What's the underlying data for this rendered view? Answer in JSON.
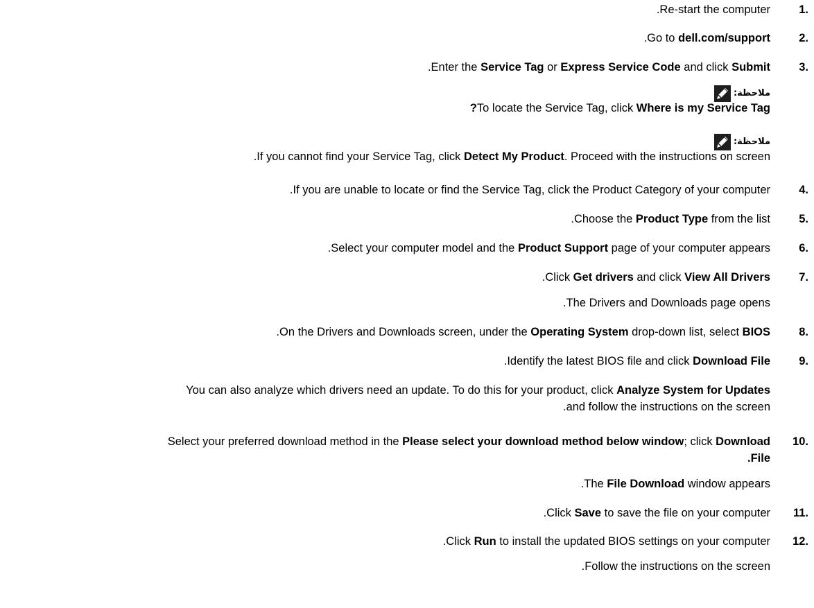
{
  "steps": [
    {
      "num": ".1",
      "parts": [
        {
          "t": ".Re-start the computer"
        }
      ]
    },
    {
      "num": ".2",
      "parts": [
        {
          "t": ".Go to "
        },
        {
          "t": "dell.com/support",
          "b": true
        }
      ]
    },
    {
      "num": ".3",
      "parts": [
        {
          "t": ".Enter the "
        },
        {
          "t": "Service Tag",
          "b": true
        },
        {
          "t": " or "
        },
        {
          "t": "Express Service Code",
          "b": true
        },
        {
          "t": " and click "
        },
        {
          "t": "Submit",
          "b": true
        }
      ]
    },
    {
      "num": ".4",
      "parts": [
        {
          "t": ".If you are unable to locate or find the Service Tag, click the Product Category of your computer"
        }
      ]
    },
    {
      "num": ".5",
      "parts": [
        {
          "t": ".Choose the "
        },
        {
          "t": "Product Type",
          "b": true
        },
        {
          "t": " from the list"
        }
      ]
    },
    {
      "num": ".6",
      "parts": [
        {
          "t": ".Select your computer model and the "
        },
        {
          "t": "Product Support",
          "b": true
        },
        {
          "t": " page of your computer appears"
        }
      ]
    },
    {
      "num": ".7",
      "parts": [
        {
          "t": ".Click "
        },
        {
          "t": "Get drivers",
          "b": true
        },
        {
          "t": " and click "
        },
        {
          "t": "View All Drivers",
          "b": true
        }
      ]
    },
    {
      "num": ".8",
      "parts": [
        {
          "t": ".On the Drivers and Downloads screen, under the "
        },
        {
          "t": "Operating System",
          "b": true
        },
        {
          "t": " drop-down list, select "
        },
        {
          "t": "BIOS",
          "b": true
        }
      ]
    },
    {
      "num": ".9",
      "parts": [
        {
          "t": ".Identify the latest BIOS file and click "
        },
        {
          "t": "Download File",
          "b": true
        }
      ]
    },
    {
      "num": ".10",
      "parts": [
        {
          "t": "Select your preferred download method in the "
        },
        {
          "t": "Please select your download method below window",
          "b": true
        },
        {
          "t": "; click "
        },
        {
          "t": "Download",
          "b": true
        }
      ]
    },
    {
      "num": ".11",
      "parts": [
        {
          "t": ".Click "
        },
        {
          "t": "Save",
          "b": true
        },
        {
          "t": " to save the file on your computer"
        }
      ]
    },
    {
      "num": ".12",
      "parts": [
        {
          "t": ".Click "
        },
        {
          "t": "Run",
          "b": true
        },
        {
          "t": " to install the updated BIOS settings on your computer"
        }
      ]
    }
  ],
  "notes": [
    {
      "label": "ملاحظة:",
      "parts": [
        {
          "t": "?",
          "b": true
        },
        {
          "t": "To locate the Service Tag, click "
        },
        {
          "t": "Where is my Service Tag",
          "b": true
        }
      ]
    },
    {
      "label": "ملاحظة:",
      "parts": [
        {
          "t": ".If you cannot find your Service Tag, click "
        },
        {
          "t": "Detect My Product",
          "b": true
        },
        {
          "t": ". Proceed with the instructions on screen"
        }
      ]
    }
  ],
  "sublines": {
    "after7": ".The Drivers and Downloads page opens",
    "after9_a": [
      {
        "t": "You can also analyze which drivers need an update. To do this for your product, click "
      },
      {
        "t": "Analyze System for Updates",
        "b": true
      }
    ],
    "after9_b": ".and follow the instructions on the screen",
    "step10_cont": [
      {
        "t": ".File",
        "b": true
      }
    ],
    "after10": [
      {
        "t": ".The "
      },
      {
        "t": "File Download",
        "b": true
      },
      {
        "t": " window appears"
      }
    ],
    "after12": ".Follow the instructions on the screen"
  }
}
